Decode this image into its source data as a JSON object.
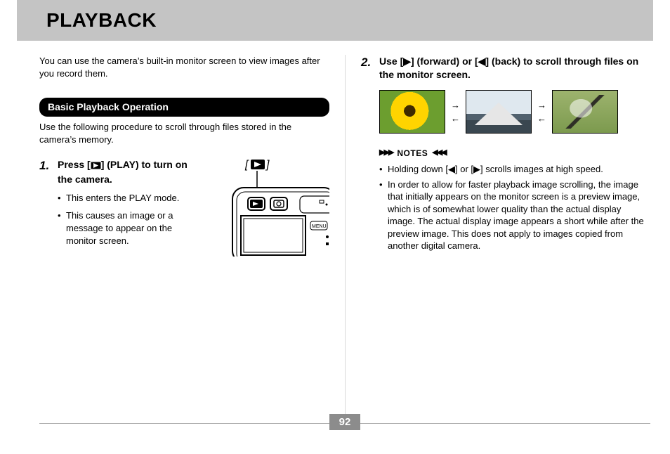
{
  "header": {
    "title": "PLAYBACK"
  },
  "intro": "You can use the camera’s built-in monitor screen to view images after you record them.",
  "section": {
    "heading": "Basic Playback Operation",
    "sub": "Use the following procedure to scroll through files stored in the camera’s memory."
  },
  "step1": {
    "num": "1.",
    "title_a": "Press [",
    "title_b": "] (PLAY) to turn on the camera.",
    "bullets": [
      "This enters the PLAY mode.",
      "This causes an image or a message to appear on the monitor screen."
    ]
  },
  "step2": {
    "num": "2.",
    "title": "Use [▶] (forward) or [◀] (back) to scroll through files on the monitor screen."
  },
  "arrows": {
    "right": "→",
    "left": "←"
  },
  "notes": {
    "label": "NOTES",
    "items": [
      "Holding down [◀] or [▶] scrolls images at high speed.",
      "In order to allow for faster playback image scrolling, the image that initially appears on the monitor screen is a preview image, which is of somewhat lower quality than the actual display image. The actual display image appears a short while after the preview image. This does not apply to images copied from another digital camera."
    ]
  },
  "pageNumber": "92"
}
